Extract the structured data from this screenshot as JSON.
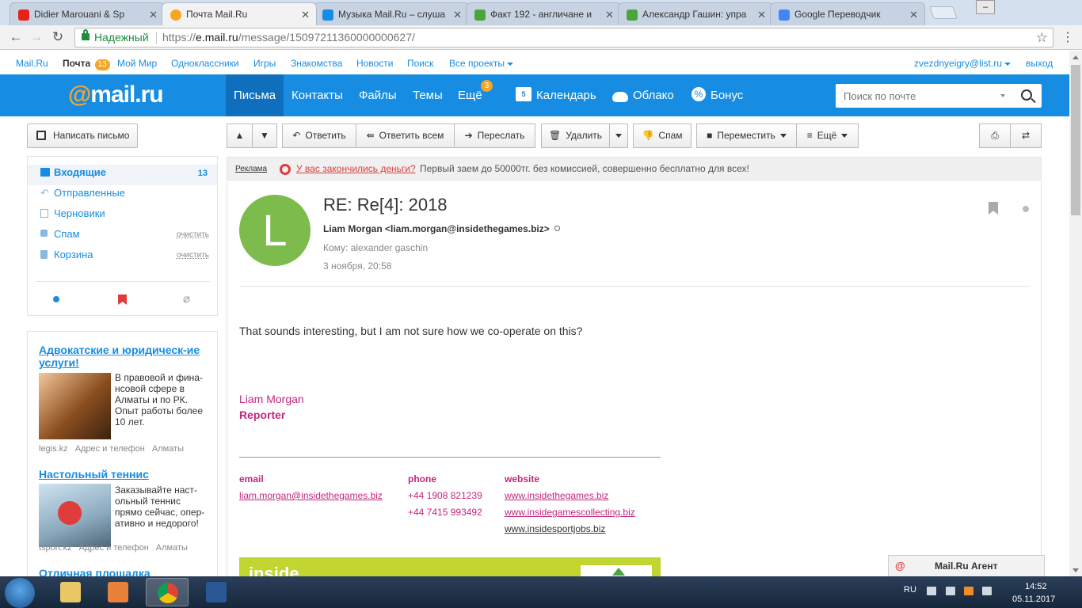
{
  "browser": {
    "tabs": [
      {
        "label": "Didier Marouani & Sp",
        "icon_color": "#e62117",
        "icon": "youtube-icon",
        "active": false
      },
      {
        "label": "Почта Mail.Ru",
        "icon_color": "#f5a623",
        "icon": "mailru-icon",
        "active": true
      },
      {
        "label": "Музыка Mail.Ru – слуша",
        "icon_color": "#168de2",
        "icon": "mailru-music-icon",
        "active": false
      },
      {
        "label": "Факт 192 - англичане и",
        "icon_color": "#4aa53c",
        "icon": "sheet-icon",
        "active": false
      },
      {
        "label": "Александр Гашин: упра",
        "icon_color": "#4aa53c",
        "icon": "sheet-icon",
        "active": false
      },
      {
        "label": "Google Переводчик",
        "icon_color": "#4285f4",
        "icon": "translate-icon",
        "active": false
      }
    ],
    "security_label": "Надежный",
    "url_prefix": "https://",
    "url_host": "e.mail.ru",
    "url_path": "/message/15097211360000000627/"
  },
  "topline": {
    "links": [
      "Mail.Ru",
      "Почта",
      "Мой Мир",
      "Одноклассники",
      "Игры",
      "Знакомства",
      "Новости",
      "Поиск",
      "Все проекты"
    ],
    "mail_badge": "13",
    "user_email": "zvezdnyeigry@list.ru",
    "logout": "выход"
  },
  "header": {
    "logo_at": "@",
    "logo_text": "mail.ru",
    "nav": [
      "Письма",
      "Контакты",
      "Файлы",
      "Темы",
      "Ещё"
    ],
    "more_badge": "3",
    "services": [
      "Календарь",
      "Облако",
      "Бонус"
    ],
    "calendar_day": "5",
    "search_placeholder": "Поиск по почте"
  },
  "sidebar": {
    "compose": "Написать письмо",
    "folders": [
      {
        "label": "Входящие",
        "count": "13",
        "clean": ""
      },
      {
        "label": "Отправленные",
        "count": "",
        "clean": ""
      },
      {
        "label": "Черновики",
        "count": "",
        "clean": ""
      },
      {
        "label": "Спам",
        "count": "",
        "clean": "очистить"
      },
      {
        "label": "Корзина",
        "count": "",
        "clean": "очистить"
      }
    ],
    "ads": [
      {
        "title": "Адвокатские и юридическ-ие услуги!",
        "text": "В правовой и фина-нсовой сфере в Алматы и по РК. Опыт работы более 10 лет.",
        "domain": "legis.kz",
        "contacts": "Адрес и телефон",
        "city": "Алматы"
      },
      {
        "title": "Настольный теннис",
        "text": "Заказывайте наст-ольный теннис прямо сейчас, опер-ативно и недорого!",
        "domain": "tsport.kz",
        "contacts": "Адрес и телефон",
        "city": "Алматы"
      },
      {
        "title": "Отличная площадка",
        "text": "",
        "domain": "",
        "contacts": "",
        "city": ""
      }
    ]
  },
  "toolbar": {
    "reply": "Ответить",
    "reply_all": "Ответить всем",
    "forward": "Переслать",
    "delete": "Удалить",
    "spam": "Спам",
    "move": "Переместить",
    "more": "Ещё"
  },
  "adline": {
    "label": "Реклама",
    "link": "У вас закончились деньги?",
    "desc": "Первый заем до 50000тг. без комиссией, совершенно бесплатно для всех!"
  },
  "message": {
    "avatar_letter": "L",
    "avatar_color": "#7cbb4c",
    "subject": "RE: Re[4]: 2018",
    "from": "Liam Morgan <liam.morgan@insidethegames.biz>",
    "to": "Кому: alexander gaschin",
    "date": "3 ноября, 20:58",
    "body": "That sounds interesting, but I am not sure how we co-operate on this?",
    "signature": {
      "name": "Liam Morgan",
      "role": "Reporter",
      "email_label": "email",
      "email": "liam.morgan@insidethegames.biz",
      "phone_label": "phone",
      "phones": [
        "+44 1908 821239",
        "+44 7415 993492"
      ],
      "website_label": "website",
      "websites": [
        "www.insidethegames.biz",
        "www.insidegamescollecting.biz",
        "www.insidesportjobs.biz"
      ]
    },
    "banner_text": "inside"
  },
  "agent": {
    "label": "Mail.Ru Агент"
  },
  "taskbar": {
    "lang": "RU",
    "time": "14:52",
    "date": "05.11.2017"
  }
}
